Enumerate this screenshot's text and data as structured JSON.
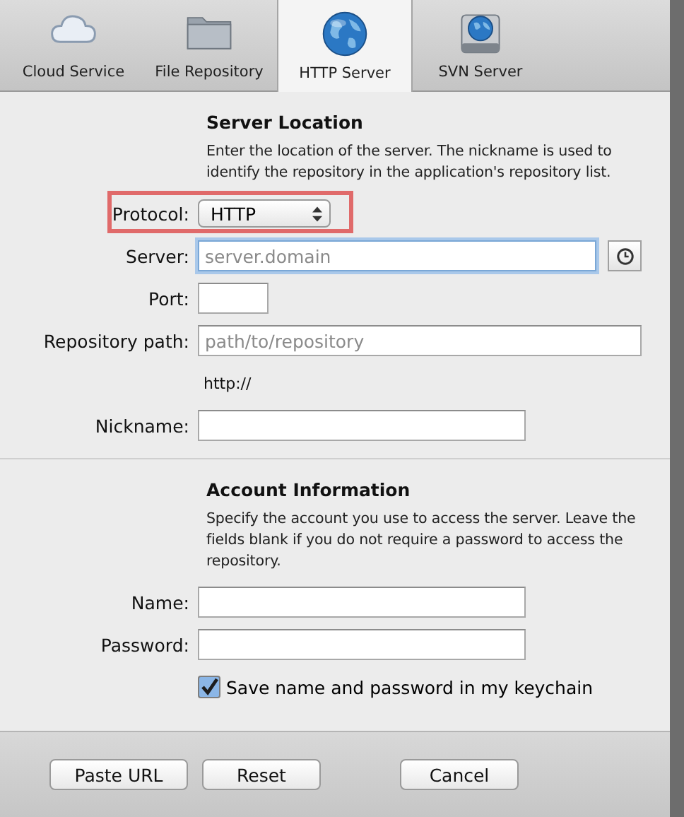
{
  "tabs": [
    {
      "label": "Cloud Service",
      "selected": false
    },
    {
      "label": "File Repository",
      "selected": false
    },
    {
      "label": "HTTP Server",
      "selected": true
    },
    {
      "label": "SVN Server",
      "selected": false
    }
  ],
  "sections": [
    {
      "title": "Server Location",
      "description": "Enter the location of the server. The nickname is used to identify the repository in the application's repository list.",
      "rows": [
        {
          "kind": "popup",
          "label": "Protocol:",
          "value": "HTTP",
          "highlighted": true
        },
        {
          "kind": "text",
          "label": "Server:",
          "placeholder": "server.domain",
          "focused": true,
          "history_button": true
        },
        {
          "kind": "text",
          "label": "Port:"
        },
        {
          "kind": "text",
          "label": "Repository path:",
          "placeholder": "path/to/repository"
        },
        {
          "kind": "note",
          "text": "http://"
        },
        {
          "kind": "text",
          "label": "Nickname:"
        }
      ]
    },
    {
      "title": "Account Information",
      "description": "Specify the account you use to access the server. Leave the fields blank if you do not require a password to access the repository.",
      "rows": [
        {
          "kind": "text",
          "label": "Name:"
        },
        {
          "kind": "password",
          "label": "Password:"
        },
        {
          "kind": "checkbox",
          "text": "Save name and password in my keychain",
          "checked": true
        }
      ]
    }
  ],
  "buttons": [
    "Paste URL",
    "Reset",
    "Cancel"
  ]
}
